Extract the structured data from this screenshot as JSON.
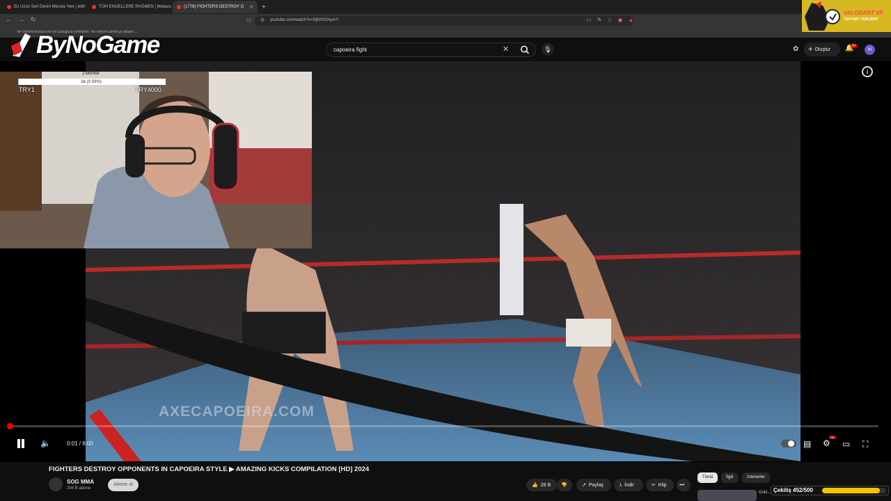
{
  "browser": {
    "tabs": [
      {
        "label": "En Uzun Seri Derim Mevsla Yeni | leith",
        "active": false
      },
      {
        "label": "TÜM ENGELLERE RAĞMEN | Medaru",
        "active": false
      },
      {
        "label": "(1778) FIGHTERS DESTROY O",
        "active": true
      }
    ],
    "new_tab_icon": "plus-icon",
    "url": "youtube.com/watch?v=SjKNV2nyorY",
    "bookmarks_text": "Yer imlerini buraya yer imi çubuğuna yerleştirin. Yer imlerini şimdi içe aktarın..."
  },
  "youtube": {
    "search_value": "capoeira fight",
    "create_label": "Oluştur",
    "notification_count": "9+",
    "avatar_letter": "H"
  },
  "player": {
    "watermark": "AXECAPOEIRA.COM",
    "time": "0:01 / 8:00",
    "progress_fraction": 0.002,
    "hd_badge": "HD",
    "accent_color": "#ff0000"
  },
  "video_meta": {
    "title": "FIGHTERS DESTROY OPPONENTS IN CAPOEIRA STYLE ▶ AMAZING KICKS COMPILATION [HD] 2024",
    "channel_name": "SOG MMA",
    "channel_subs": "294 B abone",
    "subscribe_label": "Abone ol",
    "likes": "26 B",
    "share_label": "Paylaş",
    "download_label": "İndir",
    "clip_label": "Klip",
    "more_label": "•••",
    "chips": [
      "Tümü",
      "İlgili",
      "İzlenenler"
    ],
    "rec_title": "Gokl..."
  },
  "stream_overlay": {
    "logo_text": "ByNoGame",
    "donation": {
      "title": "2.Monitör",
      "amount": "1₺ (0.03%)",
      "min_label": "TRY1",
      "max_label": "TRY4000",
      "fraction": 0.0003
    },
    "valorant": {
      "title": "VALORANT VP",
      "subtitle": "7/24 HIZLI TESLİMAT"
    },
    "giveaway": {
      "label": "Çekiliş 452/500",
      "current": 452,
      "goal": 500,
      "color": "#f5c400"
    }
  }
}
